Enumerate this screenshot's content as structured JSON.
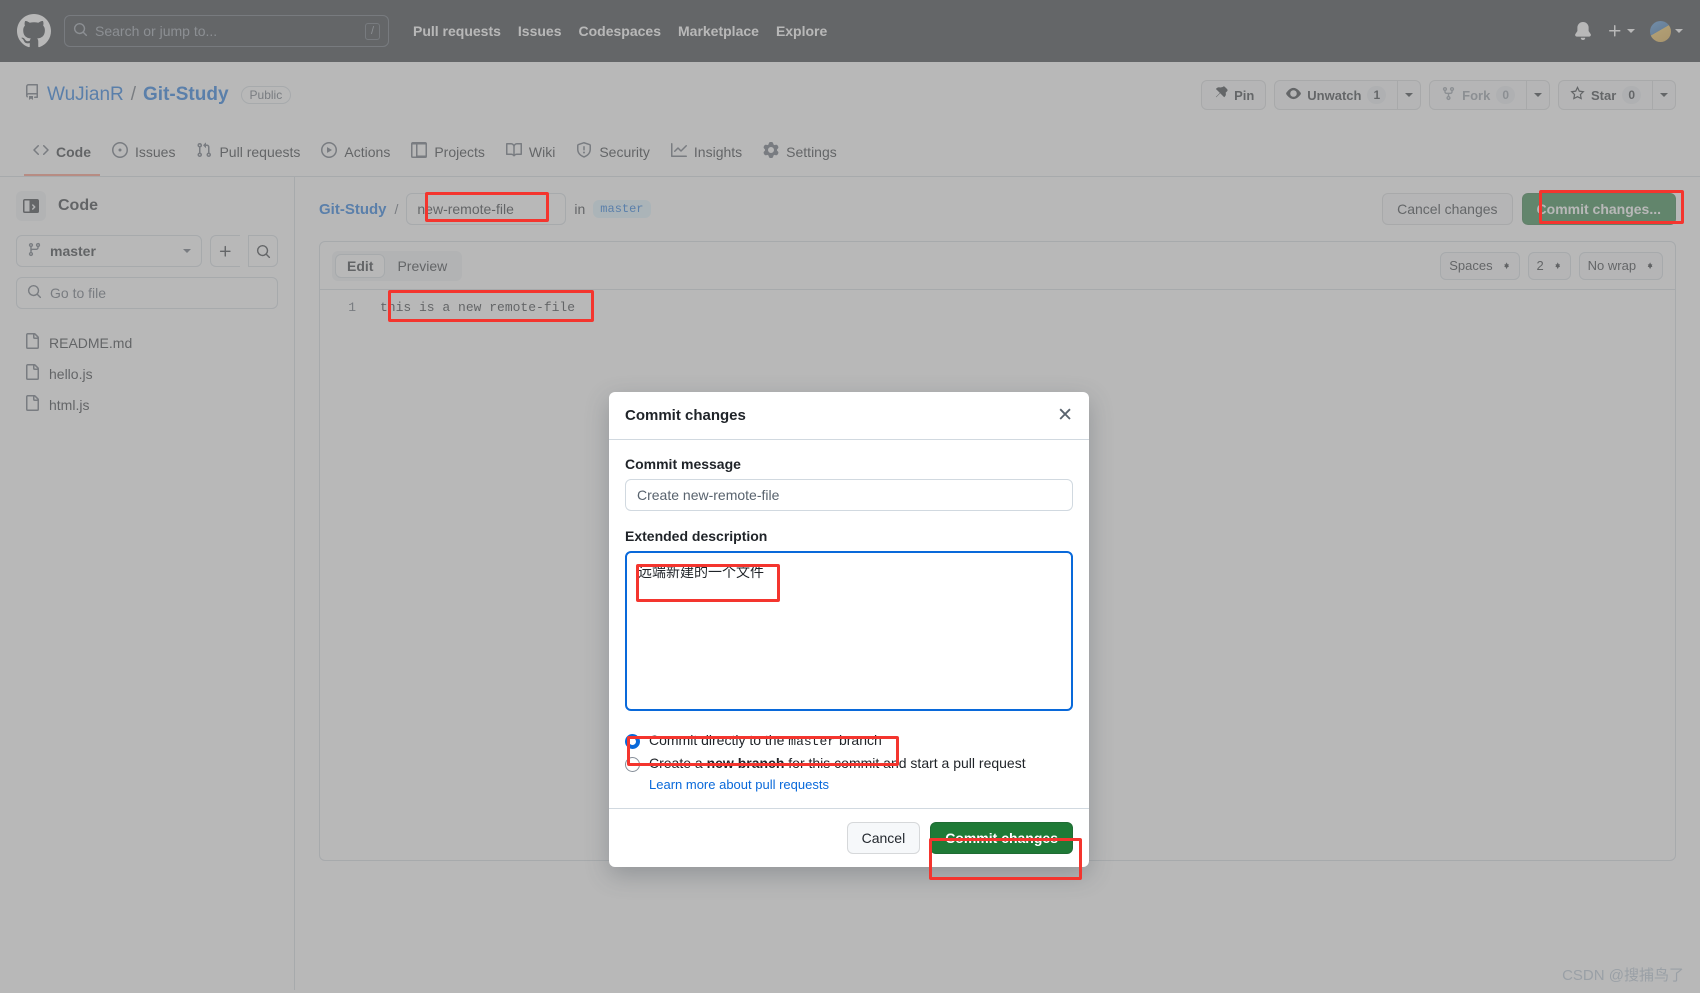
{
  "header": {
    "logo_icon": "github-mark-icon",
    "search": {
      "placeholder": "Search or jump to...",
      "shortcut": "/",
      "icon": "search-icon"
    },
    "nav": [
      "Pull requests",
      "Issues",
      "Codespaces",
      "Marketplace",
      "Explore"
    ],
    "notifications_icon": "bell-icon",
    "create_new_icon": "plus-icon",
    "avatar_icon": "user-avatar"
  },
  "repo": {
    "icon": "repo-icon",
    "owner": "WuJianR",
    "separator": "/",
    "name": "Git-Study",
    "visibility": "Public",
    "actions": {
      "pin": {
        "label": "Pin",
        "icon": "pin-icon"
      },
      "unwatch": {
        "label": "Unwatch",
        "count": "1",
        "icon": "eye-icon"
      },
      "fork": {
        "label": "Fork",
        "count": "0",
        "icon": "fork-icon"
      },
      "star": {
        "label": "Star",
        "count": "0",
        "icon": "star-icon"
      }
    },
    "tabs": [
      {
        "label": "Code",
        "icon": "code-icon",
        "active": true
      },
      {
        "label": "Issues",
        "icon": "issue-opened-icon",
        "active": false
      },
      {
        "label": "Pull requests",
        "icon": "git-pull-request-icon",
        "active": false
      },
      {
        "label": "Actions",
        "icon": "play-icon",
        "active": false
      },
      {
        "label": "Projects",
        "icon": "table-icon",
        "active": false
      },
      {
        "label": "Wiki",
        "icon": "book-icon",
        "active": false
      },
      {
        "label": "Security",
        "icon": "shield-icon",
        "active": false
      },
      {
        "label": "Insights",
        "icon": "graph-icon",
        "active": false
      },
      {
        "label": "Settings",
        "icon": "gear-icon",
        "active": false
      }
    ]
  },
  "sidebar": {
    "panel_icon": "sidebar-expand-icon",
    "title": "Code",
    "branch": {
      "name": "master",
      "icon": "branch-icon"
    },
    "add_icon": "plus-icon",
    "search_icon": "search-icon",
    "go_to_file_placeholder": "Go to file",
    "files": [
      {
        "name": "README.md",
        "icon": "file-icon"
      },
      {
        "name": "hello.js",
        "icon": "file-icon"
      },
      {
        "name": "html.js",
        "icon": "file-icon"
      }
    ]
  },
  "main": {
    "path": {
      "repo": "Git-Study",
      "slash": "/",
      "filename": "new-remote-file",
      "in_word": "in",
      "branch": "master"
    },
    "cancel_label": "Cancel changes",
    "commit_label": "Commit changes...",
    "editor_tabs": [
      {
        "label": "Edit",
        "active": true
      },
      {
        "label": "Preview",
        "active": false
      }
    ],
    "toolbar_selects": [
      {
        "value": "Spaces"
      },
      {
        "value": "2"
      },
      {
        "value": "No wrap"
      }
    ],
    "code": {
      "line_number": "1",
      "line_text": "this is a new remote-file"
    }
  },
  "modal": {
    "title": "Commit changes",
    "close_icon": "close-icon",
    "commit_message_label": "Commit message",
    "commit_message_value": "Create new-remote-file",
    "extended_description_label": "Extended description",
    "extended_description_value": "远端新建的一个文件",
    "option_direct_prefix": "Commit directly to the ",
    "option_direct_branch": "master",
    "option_direct_suffix": " branch",
    "option_new_prefix": "Create a ",
    "option_new_bold": "new branch",
    "option_new_suffix": " for this commit and start a pull request",
    "learn_more": "Learn more about pull requests",
    "cancel_label": "Cancel",
    "submit_label": "Commit changes"
  },
  "watermark": "CSDN @搜捕鸟了",
  "colors": {
    "header_bg": "#24292f",
    "accent_blue": "#0969da",
    "commit_green": "#1f7a37",
    "annotation_red": "#f4352e",
    "active_tab_underline": "#fd8c73"
  }
}
